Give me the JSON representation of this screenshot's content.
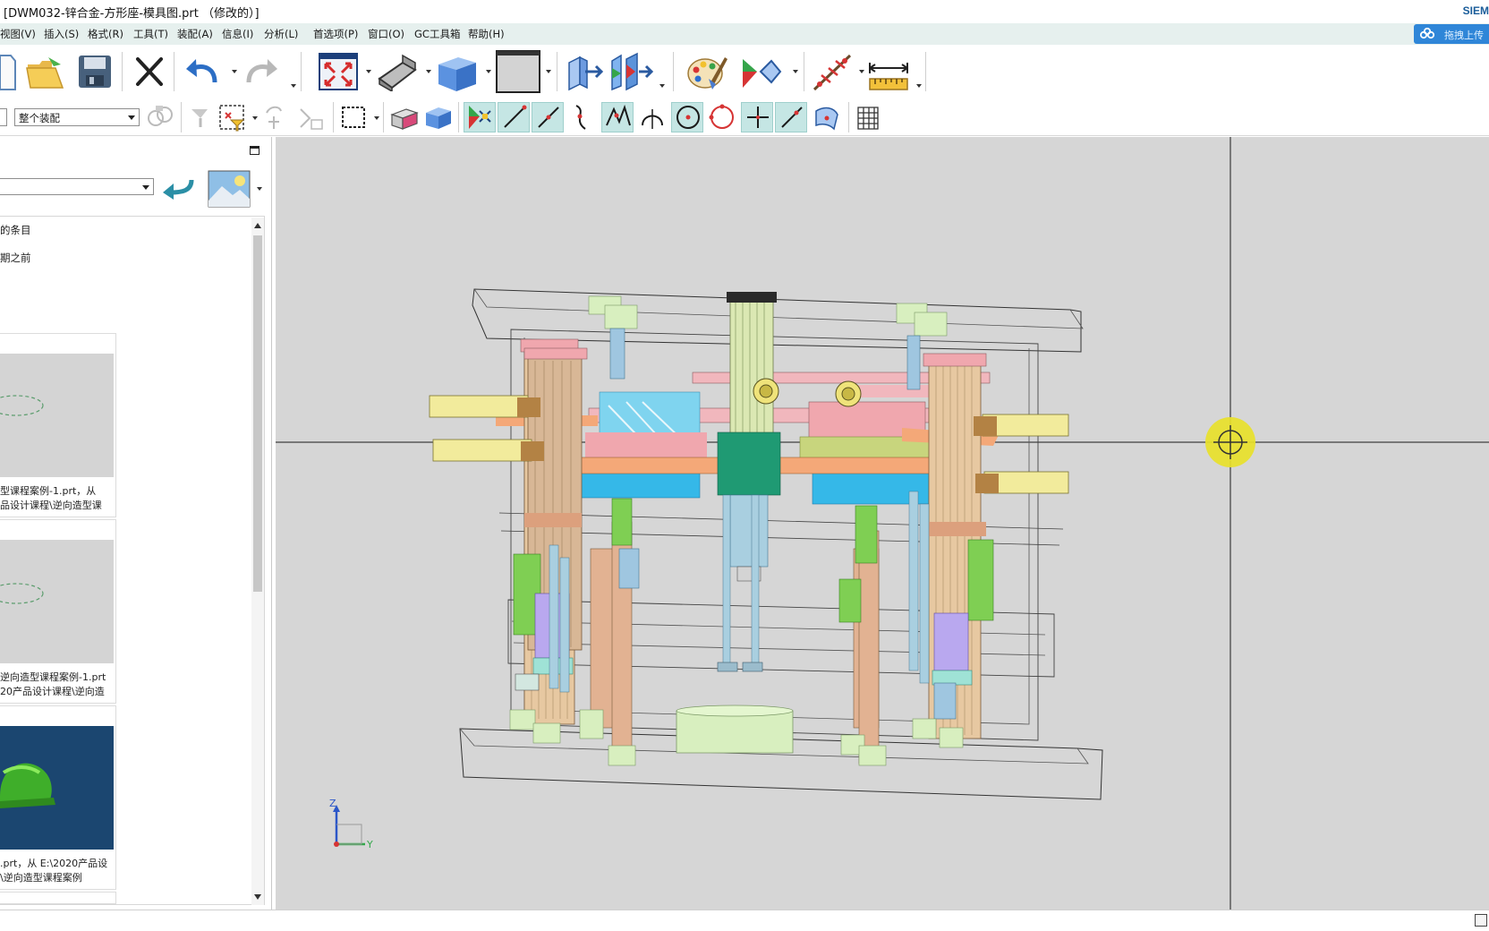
{
  "window": {
    "title": "[DWM032-锌合金-方形座-模具图.prt （修改的）]",
    "brand": "SIEM"
  },
  "menu": {
    "items": [
      "视图(V)",
      "插入(S)",
      "格式(R)",
      "工具(T)",
      "装配(A)",
      "信息(I)",
      "分析(L)",
      "首选项(P)",
      "窗口(O)",
      "GC工具箱",
      "帮助(H)"
    ],
    "upload_label": "拖拽上传"
  },
  "toolbar": {
    "selection_filter": "整个装配"
  },
  "left_panel": {
    "history_groups": [
      "的条目",
      "期之前"
    ],
    "parts": [
      {
        "caption_line1": "型课程案例-1.prt，从",
        "caption_line2": "品设计课程\\逆向造型课"
      },
      {
        "caption_line1": "逆向造型课程案例-1.prt",
        "caption_line2": "20产品设计课程\\逆向造"
      },
      {
        "caption_line1": ".prt，从 E:\\2020产品设",
        "caption_line2": "\\逆向造型课程案例"
      }
    ]
  },
  "viewport": {
    "background": "#d6d6d6",
    "triad": {
      "z_label": "Z",
      "y_label": "Y"
    }
  },
  "colors": {
    "menu_bg": "#e6f0ee",
    "upload_btn": "#2f86d8",
    "brand": "#1a5d9a",
    "highlight": "#c5e6e4"
  }
}
